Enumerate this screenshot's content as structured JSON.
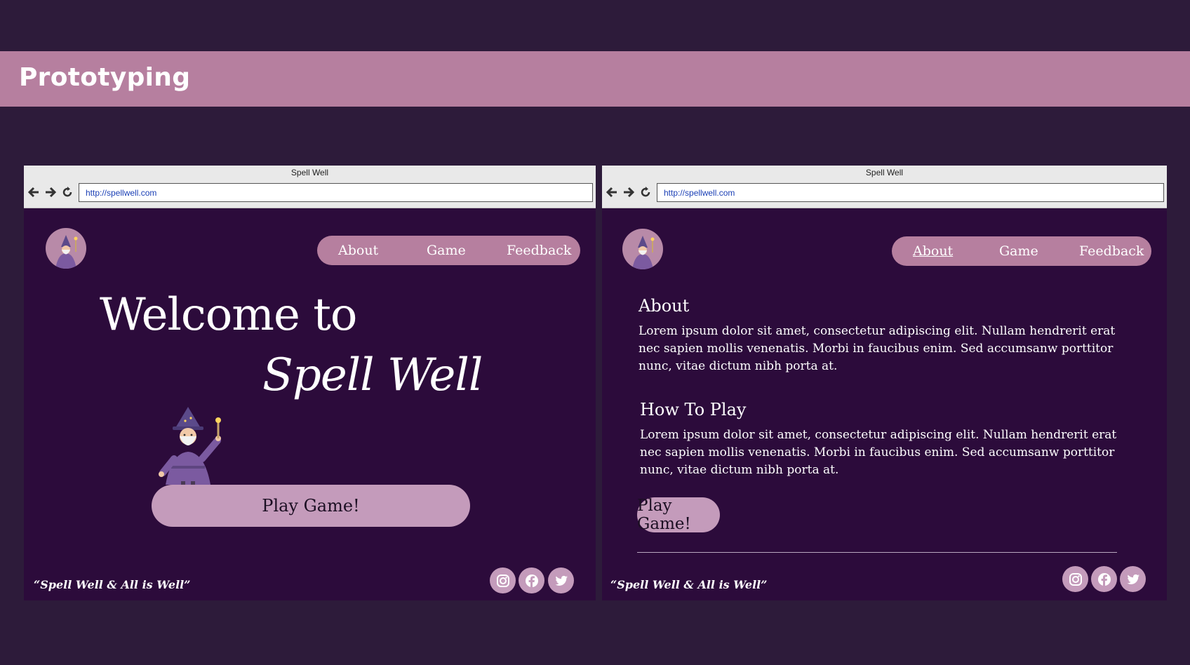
{
  "slide": {
    "title": "Prototyping"
  },
  "browser": {
    "window_title": "Spell Well",
    "url": "http://spellwell.com"
  },
  "nav": {
    "items": [
      {
        "label": "About"
      },
      {
        "label": "Game"
      },
      {
        "label": "Feedback"
      }
    ]
  },
  "home": {
    "welcome": "Welcome to",
    "brand": "Spell Well",
    "play_button": "Play Game!"
  },
  "about_page": {
    "sections": [
      {
        "title": "About",
        "body": "Lorem ipsum dolor sit amet, consectetur adipiscing elit. Nullam hendrerit erat nec sapien mollis venenatis. Morbi in faucibus enim. Sed accumsanw porttitor nunc, vitae dictum nibh porta at."
      },
      {
        "title": "How To Play",
        "body": "Lorem ipsum dolor sit amet, consectetur adipiscing elit. Nullam hendrerit erat nec sapien mollis venenatis. Morbi in faucibus enim. Sed accumsanw porttitor nunc, vitae dictum nibh porta at."
      }
    ],
    "play_button": "Play Game!",
    "active_nav": "About"
  },
  "footer": {
    "motto": "“Spell Well & All is Well”",
    "social_icons": [
      "instagram-icon",
      "facebook-icon",
      "twitter-icon"
    ]
  },
  "colors": {
    "page_bg": "#2d1b3a",
    "banner": "#b67f9f",
    "browser_bg": "#2c0b3b",
    "pill": "#b67f9f",
    "button": "#c49bbb"
  }
}
